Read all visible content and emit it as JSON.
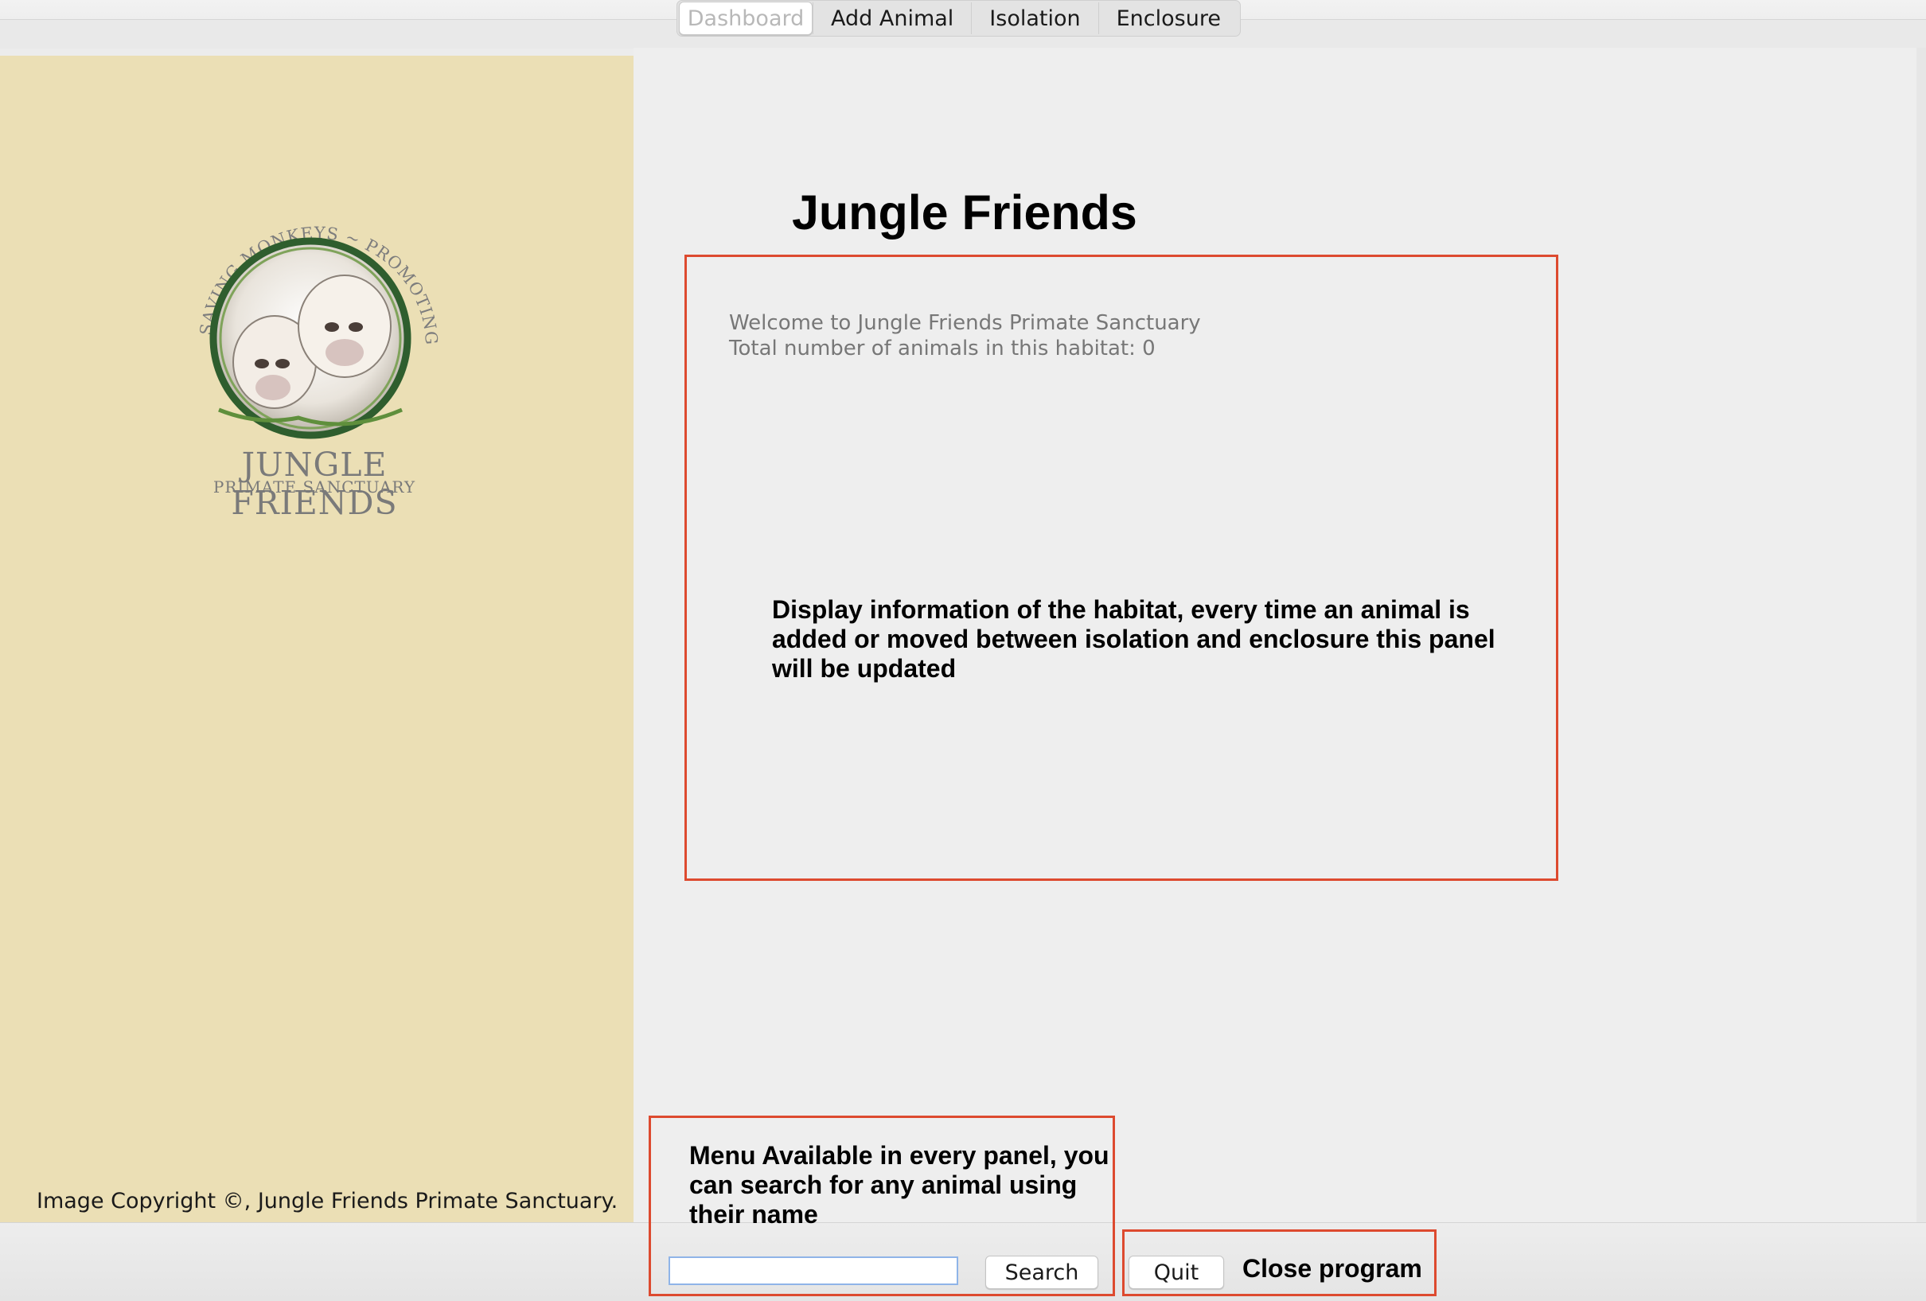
{
  "tabs": [
    {
      "label": "Dashboard",
      "active": true
    },
    {
      "label": "Add Animal",
      "active": false
    },
    {
      "label": "Isolation",
      "active": false
    },
    {
      "label": "Enclosure",
      "active": false
    }
  ],
  "sidebar": {
    "logo": {
      "arc_text": "SAVING MONKEYS ~ PROMOTING COMPASSION",
      "title": "JUNGLE FRIENDS",
      "subtitle": "PRIMATE SANCTUARY"
    },
    "copyright": "Image Copyright ©, Jungle Friends Primate Sanctuary."
  },
  "main": {
    "title": "Jungle Friends",
    "info": {
      "welcome": "Welcome to Jungle Friends Primate Sanctuary",
      "total": "Total number of animals in this habitat: 0"
    },
    "annotations": {
      "habitat_note": "Display information of the habitat, every time an animal is added or moved between isolation and enclosure this panel will be updated",
      "menu_note": "Menu Available in every panel, you can search for any animal using their name",
      "quit_note": "Close program"
    }
  },
  "bottom": {
    "search_value": "",
    "search_button": "Search",
    "quit_button": "Quit"
  },
  "colors": {
    "sidebar_bg": "#ebdfb5",
    "annotation_border": "#dd4a2f",
    "input_focus_border": "#8fb4e8"
  }
}
